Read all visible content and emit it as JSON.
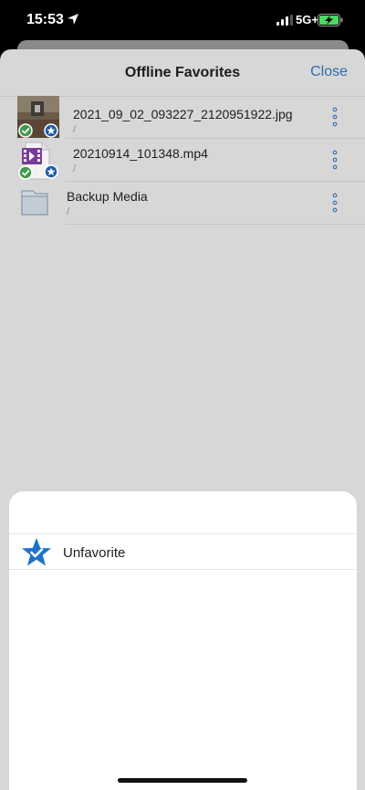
{
  "status_bar": {
    "time": "15:53",
    "network": "5G+"
  },
  "header": {
    "title": "Offline Favorites",
    "close_label": "Close"
  },
  "files": [
    {
      "name": "2021_09_02_093227_2120951922.jpg",
      "path": "/",
      "thumb_icon": "photo-thumbnail-icon",
      "badges": [
        "offline-check-icon",
        "favorite-star-icon"
      ]
    },
    {
      "name": "20210914_101348.mp4",
      "path": "/",
      "thumb_icon": "video-file-icon",
      "badges": [
        "offline-check-icon",
        "favorite-star-icon"
      ]
    },
    {
      "name": "Backup Media",
      "path": "/",
      "thumb_icon": "folder-icon",
      "badges": []
    }
  ],
  "action_sheet": {
    "items": [
      {
        "label": "Unfavorite",
        "icon": "unfavorite-star-check-icon"
      }
    ]
  },
  "colors": {
    "accent": "#2a6fb0",
    "check_green": "#3f9a4a",
    "star_blue": "#1e73c8"
  }
}
